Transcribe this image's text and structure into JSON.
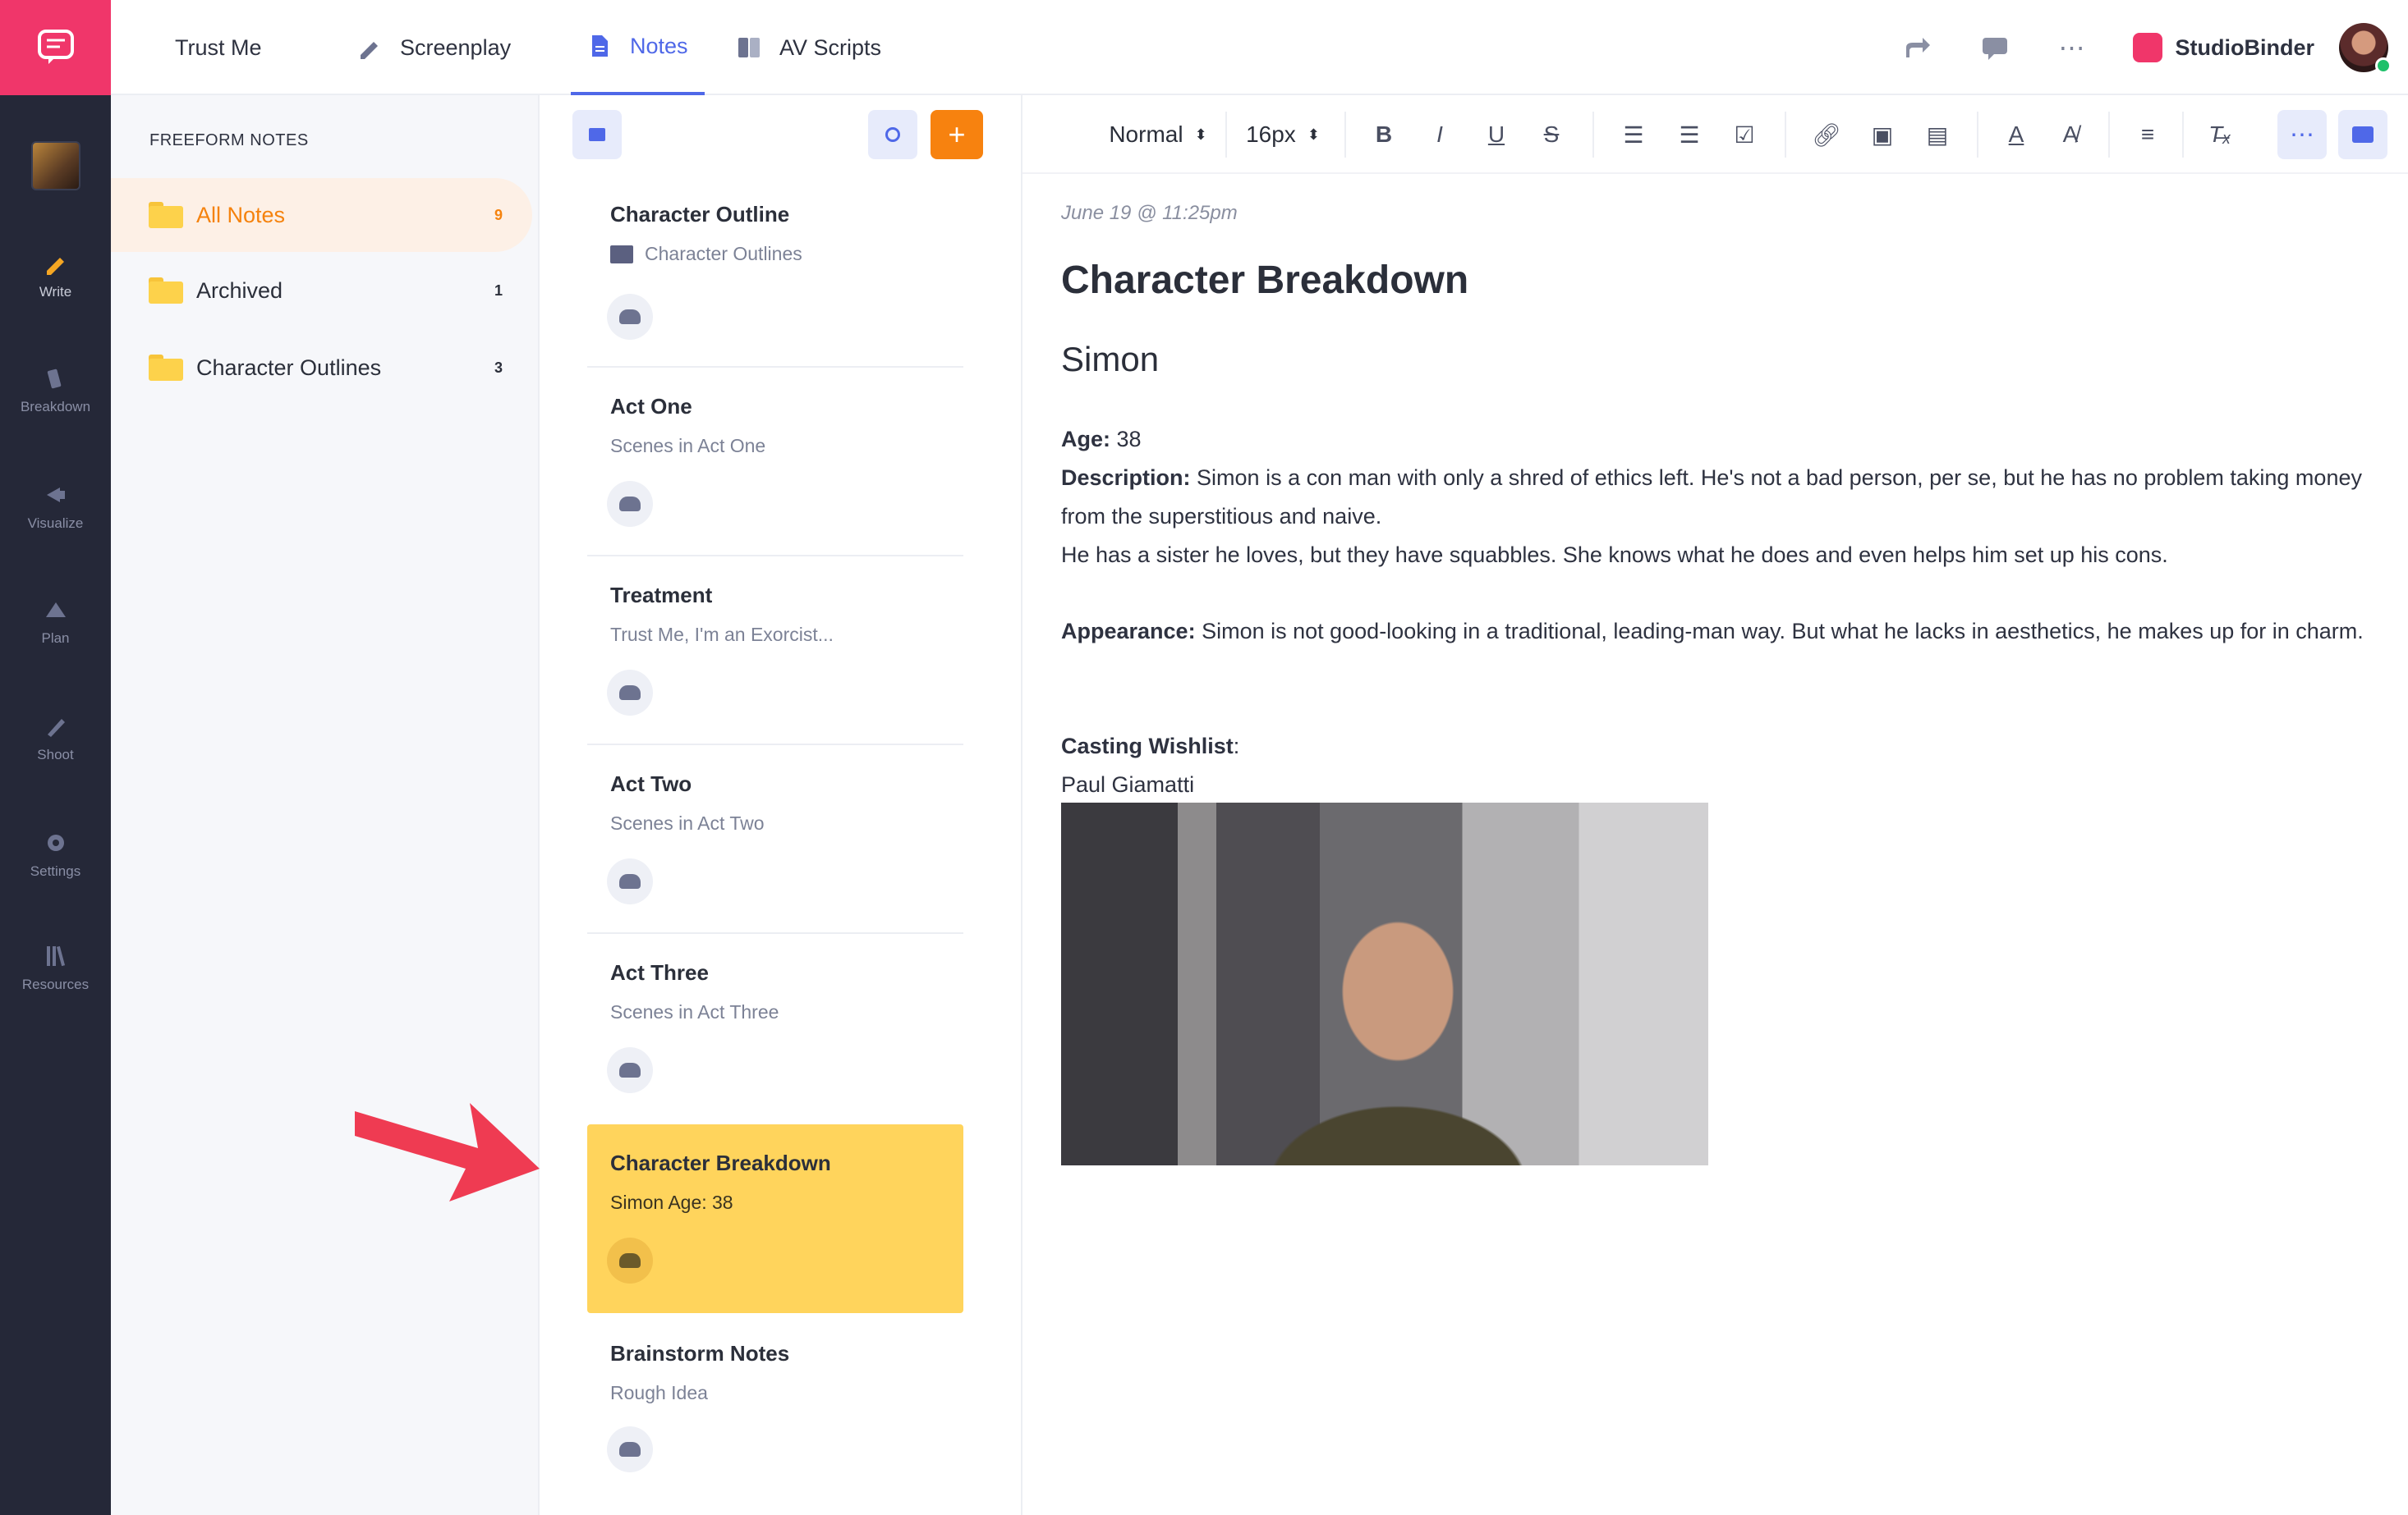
{
  "rail": {
    "items": [
      {
        "label": "Write",
        "icon": "pencil-icon"
      },
      {
        "label": "Breakdown",
        "icon": "breakdown-icon"
      },
      {
        "label": "Visualize",
        "icon": "visualize-icon"
      },
      {
        "label": "Plan",
        "icon": "plan-icon"
      },
      {
        "label": "Shoot",
        "icon": "shoot-icon"
      },
      {
        "label": "Settings",
        "icon": "gear-icon"
      },
      {
        "label": "Resources",
        "icon": "library-icon"
      }
    ]
  },
  "topbar": {
    "project_title": "Trust Me",
    "tabs": [
      {
        "label": "Screenplay",
        "icon": "pencil-icon"
      },
      {
        "label": "Notes",
        "icon": "document-icon",
        "active": true
      },
      {
        "label": "AV Scripts",
        "icon": "av-icon"
      }
    ],
    "brand": "StudioBinder"
  },
  "folders": {
    "title": "FREEFORM NOTES",
    "items": [
      {
        "label": "All Notes",
        "count": "9",
        "active": true
      },
      {
        "label": "Archived",
        "count": "1"
      },
      {
        "label": "Character Outlines",
        "count": "3"
      }
    ]
  },
  "notes": {
    "items": [
      {
        "title": "Character Outline",
        "subtitle": "Character Outlines",
        "has_folder": true
      },
      {
        "title": "Act One",
        "subtitle": "Scenes in Act One"
      },
      {
        "title": "Treatment",
        "subtitle": "Trust Me, I'm an Exorcist..."
      },
      {
        "title": "Act Two",
        "subtitle": "Scenes in Act Two"
      },
      {
        "title": "Act Three",
        "subtitle": "Scenes in Act Three"
      },
      {
        "title": "Character Breakdown",
        "subtitle": "Simon Age: 38",
        "selected": true
      },
      {
        "title": "Brainstorm Notes",
        "subtitle": "Rough Idea"
      }
    ]
  },
  "toolbar": {
    "style": "Normal",
    "size": "16px"
  },
  "document": {
    "date": "June 19 @ 11:25pm",
    "heading": "Character Breakdown",
    "subheading": "Simon",
    "age_label": "Age:",
    "age_value": " 38",
    "description_label": "Description:",
    "description_text": " Simon is a con man with only a shred of ethics left. He's not a bad person, per se, but he has no problem taking money from the superstitious and naive.",
    "description_line2": "He has a sister he loves, but they have squabbles. She knows what he does and even helps him set up his cons.",
    "appearance_label": "Appearance:",
    "appearance_text": " Simon is not good-looking in a traditional, leading-man way. But what he lacks in aesthetics, he makes up for in charm.",
    "casting_label": "Casting Wishlist",
    "casting_colon": ":",
    "casting_name": "Paul Giamatti"
  },
  "colors": {
    "brand": "#f0366a",
    "accent": "#4f68e8",
    "orange": "#f7820f",
    "selected_note": "#ffd45c",
    "rail": "#252838"
  }
}
